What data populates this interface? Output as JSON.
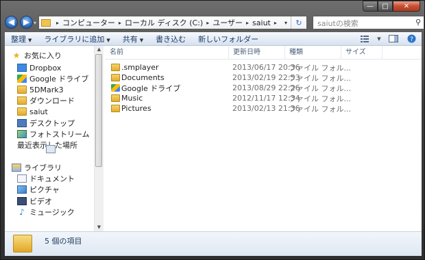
{
  "window": {
    "caption_buttons": {
      "minimize": "—",
      "maximize": "□",
      "close": "✕"
    }
  },
  "nav": {
    "back_glyph": "◀",
    "forward_glyph": "▶",
    "recent_glyph": "▾"
  },
  "address": {
    "breadcrumbs": [
      "コンピューター",
      "ローカル ディスク (C:)",
      "ユーザー",
      "saiut"
    ],
    "separator": "▸",
    "dropdown_glyph": "▾",
    "refresh_glyph": "↻"
  },
  "search": {
    "placeholder": "saiutの検索",
    "icon_glyph": "⚲"
  },
  "toolbar": {
    "organize": "整理",
    "add_to_library": "ライブラリに追加",
    "share": "共有",
    "burn": "書き込む",
    "new_folder": "新しいフォルダー",
    "dropdown_glyph": "▼"
  },
  "navpane": {
    "favorites_label": "お気に入り",
    "favorites": [
      "Dropbox",
      "Google ドライブ",
      "5DMark3",
      "ダウンロード",
      "saiut",
      "デスクトップ",
      "フォトストリーム",
      "最近表示した場所"
    ],
    "libraries_label": "ライブラリ",
    "libraries": [
      "ドキュメント",
      "ピクチャ",
      "ビデオ",
      "ミュージック"
    ]
  },
  "columns": {
    "name": "名前",
    "modified": "更新日時",
    "type": "種類",
    "size": "サイズ",
    "sort_glyph": "^"
  },
  "files": [
    {
      "name": ".smplayer",
      "modified": "2013/06/17 20:36",
      "type": "ファイル フォル..."
    },
    {
      "name": "Documents",
      "modified": "2013/02/19 22:53",
      "type": "ファイル フォル..."
    },
    {
      "name": "Google ドライブ",
      "modified": "2013/08/29 22:26",
      "type": "ファイル フォル..."
    },
    {
      "name": "Music",
      "modified": "2012/11/17 12:34",
      "type": "ファイル フォル..."
    },
    {
      "name": "Pictures",
      "modified": "2013/02/13 21:36",
      "type": "ファイル フォル..."
    }
  ],
  "status": {
    "item_count": "5 個の項目"
  }
}
